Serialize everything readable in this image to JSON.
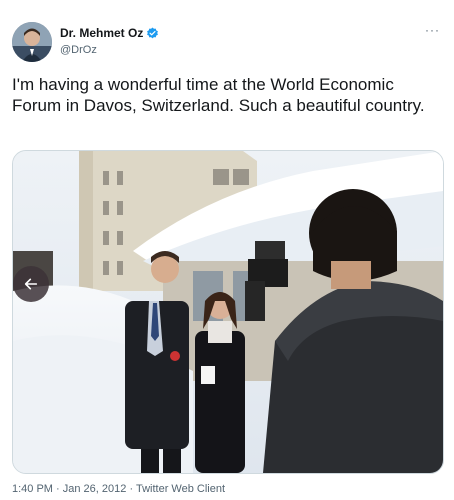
{
  "author": {
    "name": "Dr. Mehmet Oz",
    "handle": "@DrOz",
    "verified": true
  },
  "tweet": {
    "text": "I'm having a wonderful time at the World Economic Forum in Davos, Switzerland. Such a beautiful country."
  },
  "meta": {
    "time": "1:40 PM",
    "date": "Jan 26, 2012",
    "source": "Twitter Web Client",
    "separator": "·"
  },
  "icons": {
    "more": "more-options-icon",
    "verified": "verified-badge-icon",
    "prev": "arrow-left-icon"
  },
  "colors": {
    "text": "#14171a",
    "secondary": "#536471",
    "verified": "#1d9bf0"
  }
}
